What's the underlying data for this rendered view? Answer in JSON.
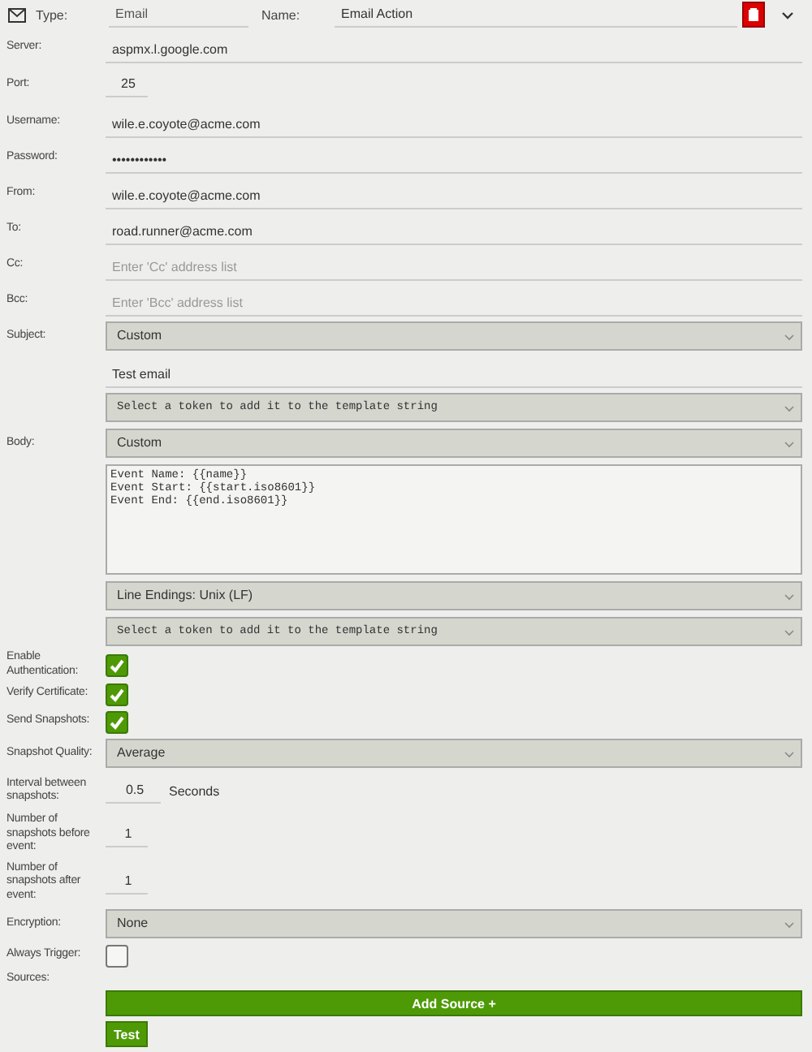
{
  "header": {
    "type_label": "Type:",
    "type_value": "Email",
    "name_label": "Name:",
    "name_value": "Email Action"
  },
  "fields": [
    {
      "kind": "text",
      "label": "Server:",
      "value": "aspmx.l.google.com"
    },
    {
      "kind": "short",
      "label": "Port:",
      "value": "25"
    },
    {
      "kind": "text",
      "label": "Username:",
      "value": "wile.e.coyote@acme.com"
    },
    {
      "kind": "text",
      "label": "Password:",
      "value": "••••••••••••"
    },
    {
      "kind": "text",
      "label": "From:",
      "value": "wile.e.coyote@acme.com"
    },
    {
      "kind": "text",
      "label": "To:",
      "value": "road.runner@acme.com"
    },
    {
      "kind": "text",
      "label": "Cc:",
      "placeholder": "Enter 'Cc' address list"
    },
    {
      "kind": "text",
      "label": "Bcc:",
      "placeholder": "Enter 'Bcc' address list"
    },
    {
      "kind": "select",
      "label": "Subject:",
      "value": "Custom"
    },
    {
      "kind": "text",
      "value": "Test email"
    },
    {
      "kind": "token",
      "value": "Select a token to add it to the template string"
    },
    {
      "kind": "select",
      "label": "Body:",
      "value": "Custom"
    },
    {
      "kind": "textarea",
      "value": "Event Name: {{name}}\nEvent Start: {{start.iso8601}}\nEvent End: {{end.iso8601}}"
    },
    {
      "kind": "select",
      "value": "Line Endings: Unix (LF)"
    },
    {
      "kind": "token",
      "value": "Select a token to add it to the template string"
    },
    {
      "kind": "checkbox",
      "label": "Enable Authentication:",
      "checked": true
    },
    {
      "kind": "checkbox",
      "label": "Verify Certificate:",
      "checked": true
    },
    {
      "kind": "checkbox",
      "label": "Send Snapshots:",
      "checked": true
    },
    {
      "kind": "select",
      "label": "Snapshot Quality:",
      "value": "Average"
    },
    {
      "kind": "short",
      "label": "Interval between snapshots:",
      "value": "0.5",
      "unit": "Seconds"
    },
    {
      "kind": "short",
      "label": "Number of snapshots before event:",
      "value": "1"
    },
    {
      "kind": "short",
      "label": "Number of snapshots after event:",
      "value": "1"
    },
    {
      "kind": "select",
      "label": "Encryption:",
      "value": "None"
    },
    {
      "kind": "checkbox",
      "label": "Always Trigger:",
      "checked": false
    },
    {
      "kind": "label",
      "label": "Sources:"
    }
  ],
  "buttons": {
    "add_source": "Add Source +",
    "test": "Test"
  }
}
